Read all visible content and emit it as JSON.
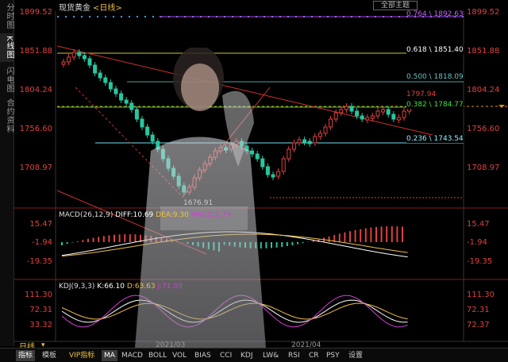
{
  "left_tabs": [
    {
      "label": "分时图",
      "active": false
    },
    {
      "label": "K线图",
      "active": true
    },
    {
      "label": "闪电图",
      "active": false
    },
    {
      "label": "合约资料",
      "active": false
    }
  ],
  "header": {
    "name": "现货黄金",
    "period": "<日线>",
    "theme_button": "全部主题"
  },
  "price_axis": {
    "left": [
      "1899.52",
      "1851.88",
      "1804.24",
      "1756.60",
      "1708.97"
    ],
    "right": [
      "1899.52",
      "1851.88",
      "1804.24",
      "1756.60",
      "1708.97"
    ]
  },
  "fib_labels": [
    "0.764 \\ 1892.63",
    "0.618 \\ 1851.40",
    "0.500 \\ 1818.09",
    "0.382 \\ 1784.77",
    "0.236 \\ 1743.54"
  ],
  "price_marks": {
    "high": "1797.94",
    "low": "1676.91"
  },
  "macd": {
    "header": {
      "label": "MACD(26,12,9)",
      "diff": "DIFF:10.69",
      "dea": "DEA:9.30",
      "macd": "MACD:2.79"
    },
    "left_axis": [
      "15.47",
      "-1.94",
      "-19.35"
    ],
    "right_axis": [
      "15.47",
      "-1.94",
      "-19.35"
    ]
  },
  "kdj": {
    "header": {
      "label": "KDJ(9,3,3)",
      "k": "K:66.10",
      "d": "D:63.63",
      "j": "J:71.03"
    },
    "left_axis": [
      "111.30",
      "72.31",
      "33.32"
    ],
    "right_axis": [
      "111.30",
      "72.31",
      "72.37"
    ]
  },
  "dates": [
    "2021/03",
    "2021/04"
  ],
  "toolbar": {
    "period": "日线",
    "tabs": [
      "指标",
      "模板"
    ],
    "indicators": [
      "VIP指标",
      "MA",
      "MACD",
      "BOLL",
      "VOL",
      "BIAS",
      "CCI",
      "KDJ",
      "LW&",
      "RSI",
      "CR",
      "PSY",
      "设置"
    ]
  },
  "colors": {
    "up": "#e04040",
    "down": "#26c6a0",
    "diff": "#ffffff",
    "dea": "#f0c040",
    "macd": "#d040d0"
  }
}
